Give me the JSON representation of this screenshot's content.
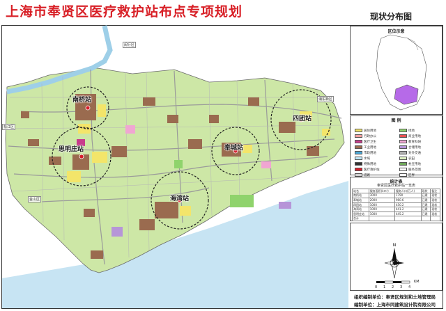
{
  "title": "上海市奉贤区医疗救护站布点专项规划",
  "subtitle": "现状分布图",
  "map_labels": {
    "minhang": "闵行区",
    "pudong": "浦东新区",
    "songjiang": "松江区",
    "jinshan": "金山区"
  },
  "stations": [
    {
      "name": "南桥站"
    },
    {
      "name": "四团站"
    },
    {
      "name": "奉城站"
    },
    {
      "name": "思明庄站"
    },
    {
      "name": "海湾站"
    }
  ],
  "inset": {
    "title": "区位示意"
  },
  "legend": {
    "title": "图 例",
    "items": [
      {
        "label": "居住用地",
        "color": "#f3e56a"
      },
      {
        "label": "绿地",
        "color": "#8fd36c"
      },
      {
        "label": "行政办公",
        "color": "#f3a0a0"
      },
      {
        "label": "商业用地",
        "color": "#e85050"
      },
      {
        "label": "医疗卫生",
        "color": "#c83c8c"
      },
      {
        "label": "教育科研",
        "color": "#f0a6d2"
      },
      {
        "label": "工业用地",
        "color": "#9a6b4f"
      },
      {
        "label": "仓储用地",
        "color": "#b695d8"
      },
      {
        "label": "市政用地",
        "color": "#4aa6d6"
      },
      {
        "label": "对外交通",
        "color": "#b0b0b0"
      },
      {
        "label": "水域",
        "color": "#bfe6f7"
      },
      {
        "label": "农田",
        "color": "#dff2c4"
      },
      {
        "label": "特殊用地",
        "color": "#323232"
      },
      {
        "label": "村庄用地",
        "color": "#6fa85a"
      },
      {
        "label": "医疗救护站",
        "color": "#d61d2a"
      },
      {
        "label": "服务范围",
        "color": "#ffffff"
      },
      {
        "label": "道路",
        "color": "#d0d0d0"
      },
      {
        "label": "区界",
        "color": "#ffffff"
      }
    ]
  },
  "stats": {
    "title": "统计表",
    "subtitle": "奉贤区医疗救护站一览表",
    "headers": [
      "站名",
      "服务面积(km²)",
      "服务人口(万人)",
      "现状",
      "备注"
    ],
    "rows": [
      [
        "南桥站",
        "3000",
        "1790",
        "已建",
        "现状"
      ],
      [
        "奉城站",
        "2000",
        "960.6",
        "已建",
        "现状"
      ],
      [
        "四团站",
        "1000",
        "450.2",
        "已建",
        "现状"
      ],
      [
        "海湾站",
        "1000",
        "441.2",
        "已建",
        "现状"
      ],
      [
        "思明庄站",
        "1000",
        "445.2",
        "已建",
        "现状"
      ],
      [
        "合计",
        "",
        "",
        "",
        ""
      ]
    ]
  },
  "scale": {
    "marks": [
      "0",
      "1",
      "2",
      "3",
      "4"
    ],
    "unit": "KM"
  },
  "footer": {
    "line1": "组织编制单位：奉贤区规划和土地管理局",
    "line2": "编制单位：上海市同建筑设计院有限公司"
  },
  "colors": {
    "title": "#d81f26",
    "land": "#cde7a6",
    "road": "#9a9a9a",
    "sea": "#c7e4f3",
    "river": "#9ecfe8",
    "station": "#d61d2a"
  }
}
